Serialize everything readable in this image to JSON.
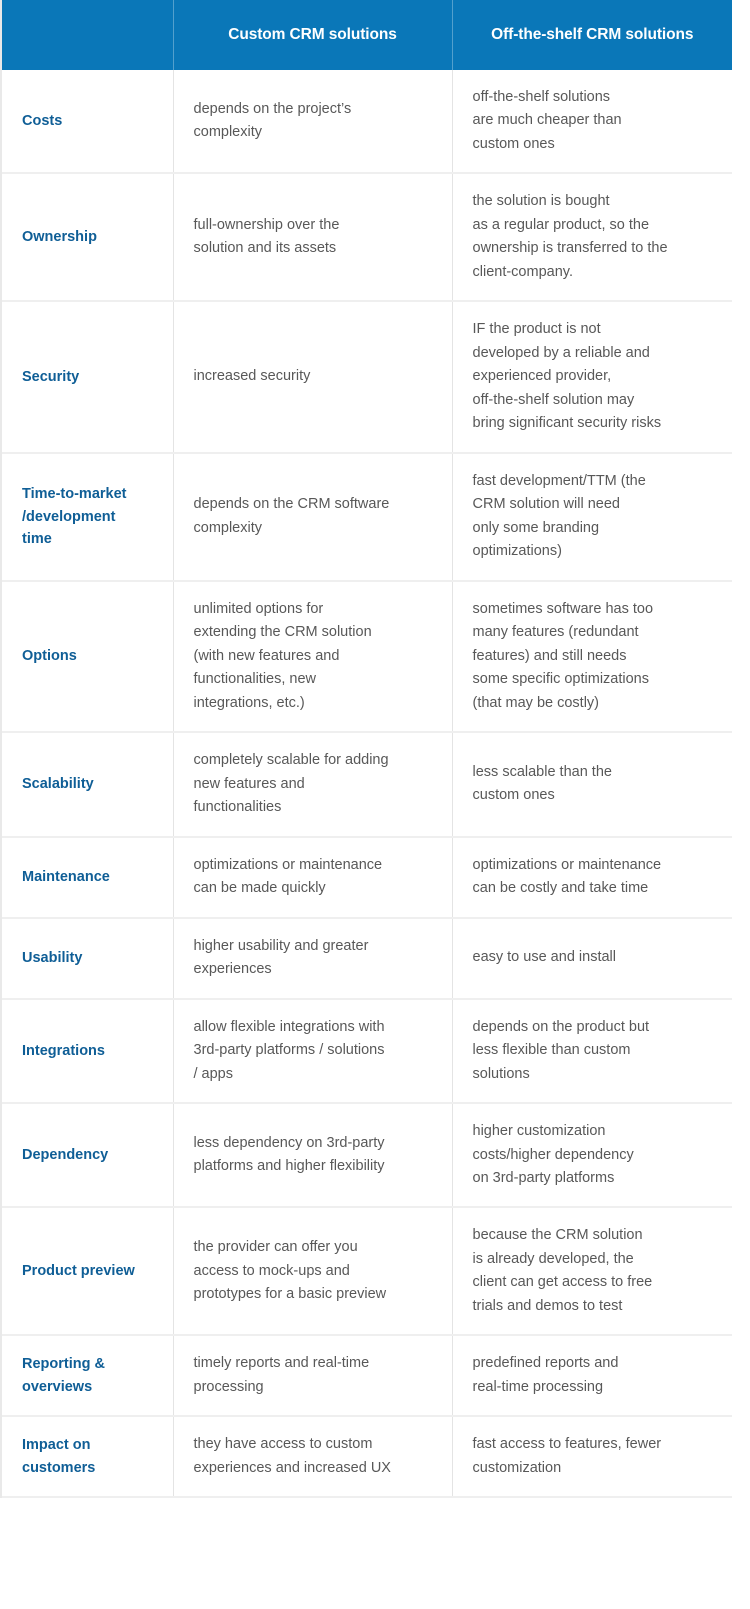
{
  "table": {
    "columns": [
      {
        "key": "label",
        "header": ""
      },
      {
        "key": "custom",
        "header": "Custom CRM solutions"
      },
      {
        "key": "ots",
        "header": "Off-the-shelf CRM solutions"
      }
    ],
    "colors": {
      "header_background": "#0a77b8",
      "header_text": "#ffffff",
      "row_label_text": "#0f5e96",
      "body_text": "#585858",
      "row_divider": "#efefef",
      "column_divider": "#e4e4e4",
      "page_background": "#ffffff"
    },
    "rows": [
      {
        "label": "Costs",
        "custom": "depends on the project’s\ncomplexity",
        "ots": "off-the-shelf solutions\nare much cheaper than\ncustom ones"
      },
      {
        "label": "Ownership",
        "custom": "full-ownership over the\nsolution and its assets",
        "ots": "the solution is bought\nas a regular product, so the\nownership is transferred to the\nclient-company."
      },
      {
        "label": "Security",
        "custom": "increased security",
        "ots": "IF the product is not\ndeveloped by a reliable and\nexperienced provider,\noff-the-shelf solution may\nbring significant security risks"
      },
      {
        "label": "Time-to-market\n/development\ntime",
        "custom": "depends on the CRM software\ncomplexity",
        "ots": "fast development/TTM (the\nCRM solution will need\nonly some branding\noptimizations)"
      },
      {
        "label": "Options",
        "custom": "unlimited options for\nextending the CRM solution\n(with new features and\nfunctionalities, new\nintegrations, etc.)",
        "ots": "sometimes software has too\nmany features (redundant\nfeatures) and still needs\nsome specific optimizations\n(that may be costly)"
      },
      {
        "label": "Scalability",
        "custom": "completely scalable for adding\nnew features and\nfunctionalities",
        "ots": "less scalable than the\ncustom ones"
      },
      {
        "label": "Maintenance",
        "custom": "optimizations or maintenance\ncan be made quickly",
        "ots": "optimizations or maintenance\ncan be costly and take time"
      },
      {
        "label": "Usability",
        "custom": "higher usability and greater\nexperiences",
        "ots": "easy to use and install"
      },
      {
        "label": "Integrations",
        "custom": "allow flexible integrations with\n3rd-party platforms / solutions\n/ apps",
        "ots": "depends on the product but\nless flexible than custom\nsolutions"
      },
      {
        "label": "Dependency",
        "custom": "less dependency on 3rd-party\nplatforms and higher flexibility",
        "ots": "higher customization\ncosts/higher dependency\non 3rd-party platforms"
      },
      {
        "label": "Product preview",
        "custom": "the provider can offer you\naccess to mock-ups and\nprototypes for a basic preview",
        "ots": "because the CRM solution\nis already developed, the\nclient can get access to free\ntrials and demos to test"
      },
      {
        "label": "Reporting &\noverviews",
        "custom": "timely reports and real-time\nprocessing",
        "ots": "predefined reports and\nreal-time processing"
      },
      {
        "label": "Impact on\ncustomers",
        "custom": "they have access to custom\nexperiences and increased UX",
        "ots": "fast access to features, fewer\ncustomization"
      }
    ]
  }
}
